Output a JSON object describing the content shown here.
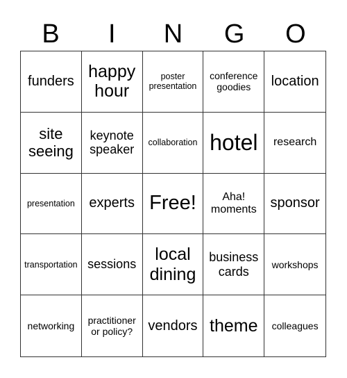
{
  "header": [
    "B",
    "I",
    "N",
    "G",
    "O"
  ],
  "cells": [
    [
      "funders",
      "happy hour",
      "poster presentation",
      "conference goodies",
      "location"
    ],
    [
      "site seeing",
      "keynote speaker",
      "collaboration",
      "hotel",
      "research"
    ],
    [
      "presentation",
      "experts",
      "Free!",
      "Aha! moments",
      "sponsor"
    ],
    [
      "transportation",
      "sessions",
      "local dining",
      "business cards",
      "workshops"
    ],
    [
      "networking",
      "practitioner or policy?",
      "vendors",
      "theme",
      "colleagues"
    ]
  ]
}
